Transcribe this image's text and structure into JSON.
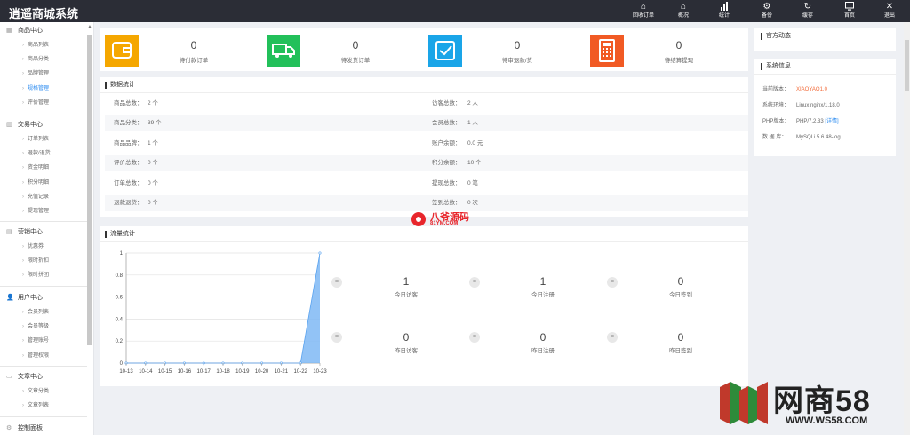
{
  "app": {
    "title": "逍遥商城系统"
  },
  "topbar": {
    "buttons": [
      {
        "label": "回收订单",
        "icon": "home-icon"
      },
      {
        "label": "概况",
        "icon": "home-icon"
      },
      {
        "label": "统计",
        "icon": "bar-chart-icon"
      },
      {
        "label": "备份",
        "icon": "gear-icon"
      },
      {
        "label": "缓存",
        "icon": "refresh-icon"
      },
      {
        "label": "首页",
        "icon": "monitor-icon"
      },
      {
        "label": "退出",
        "icon": "close-icon"
      }
    ]
  },
  "sidebar": {
    "groups": [
      {
        "title": "商品中心",
        "items": [
          "商品列表",
          "商品分类",
          "品牌管理",
          "规格管理",
          "评价管理"
        ],
        "active": "规格管理"
      },
      {
        "title": "交易中心",
        "items": [
          "订单列表",
          "退款/退货",
          "资金明细",
          "积分明细",
          "充值记录",
          "提现管理"
        ]
      },
      {
        "title": "营销中心",
        "items": [
          "优惠券",
          "限时折扣",
          "限时拼团"
        ]
      },
      {
        "title": "用户中心",
        "items": [
          "会员列表",
          "会员等级",
          "管理账号",
          "管理权限"
        ]
      },
      {
        "title": "文章中心",
        "items": [
          "文章分类",
          "文章列表"
        ]
      },
      {
        "title": "控制面板",
        "items": []
      }
    ]
  },
  "stats": [
    {
      "value": "0",
      "label": "待付款订单",
      "color": "#f5a700",
      "icon": "wallet-icon"
    },
    {
      "value": "0",
      "label": "待发货订单",
      "color": "#22c05a",
      "icon": "truck-icon"
    },
    {
      "value": "0",
      "label": "待审退款/货",
      "color": "#1aa5e8",
      "icon": "check-box-icon"
    },
    {
      "value": "0",
      "label": "待结算提现",
      "color": "#f15a24",
      "icon": "calculator-icon"
    }
  ],
  "data_stats": {
    "title": "数据统计",
    "rows": [
      {
        "l_label": "商品总数：",
        "l_value": "2 个",
        "r_label": "访客总数：",
        "r_value": "2 人"
      },
      {
        "l_label": "商品分类：",
        "l_value": "39 个",
        "r_label": "会员总数：",
        "r_value": "1 人"
      },
      {
        "l_label": "商品品牌：",
        "l_value": "1 个",
        "r_label": "账户余额：",
        "r_value": "0.0 元"
      },
      {
        "l_label": "评价总数：",
        "l_value": "0 个",
        "r_label": "积分余额：",
        "r_value": "10 个"
      },
      {
        "l_label": "订单总数：",
        "l_value": "0 个",
        "r_label": "提现总数：",
        "r_value": "0 笔"
      },
      {
        "l_label": "退款退货：",
        "l_value": "0 个",
        "r_label": "签到总数：",
        "r_value": "0 次"
      }
    ]
  },
  "traffic": {
    "title": "流量统计",
    "today": [
      {
        "value": "1",
        "label": "今日访客"
      },
      {
        "value": "1",
        "label": "今日注册"
      },
      {
        "value": "0",
        "label": "今日签到"
      }
    ],
    "yesterday": [
      {
        "value": "0",
        "label": "昨日访客"
      },
      {
        "value": "0",
        "label": "昨日注册"
      },
      {
        "value": "0",
        "label": "昨日签到"
      }
    ],
    "dot_glyph": "="
  },
  "chart_data": {
    "type": "area",
    "categories": [
      "10-13",
      "10-14",
      "10-15",
      "10-16",
      "10-17",
      "10-18",
      "10-19",
      "10-20",
      "10-21",
      "10-22",
      "10-23"
    ],
    "values": [
      0,
      0,
      0,
      0,
      0,
      0,
      0,
      0,
      0,
      0,
      1
    ],
    "ylim": [
      0,
      1
    ],
    "yticks": [
      "0",
      "0.2",
      "0.4",
      "0.6",
      "0.8",
      "1"
    ],
    "grid": true,
    "colors": {
      "fill": "#7fb8f5",
      "line": "#5aa3ef"
    }
  },
  "right": {
    "news_title": "官方动态",
    "info_title": "系统信息",
    "info": [
      {
        "k": "当前版本：",
        "v": "XIAOYAO1.0",
        "accent": true
      },
      {
        "k": "系统环境：",
        "v": "Linux nginx/1.18.0"
      },
      {
        "k": "PHP版本：",
        "v": "PHP/7.2.33",
        "link": "[详情]"
      },
      {
        "k": "数 据 库：",
        "v": "MySQLi 5.6.48-log"
      }
    ]
  },
  "watermarks": {
    "mid_main": "八爷源码",
    "mid_sub": "81YM.COM",
    "br_main": "网商58",
    "br_sub": "WWW.WS58.COM"
  },
  "colors": {
    "accent": "#f26b3a",
    "link": "#2d8cf0",
    "topbar": "#2b2d36"
  }
}
